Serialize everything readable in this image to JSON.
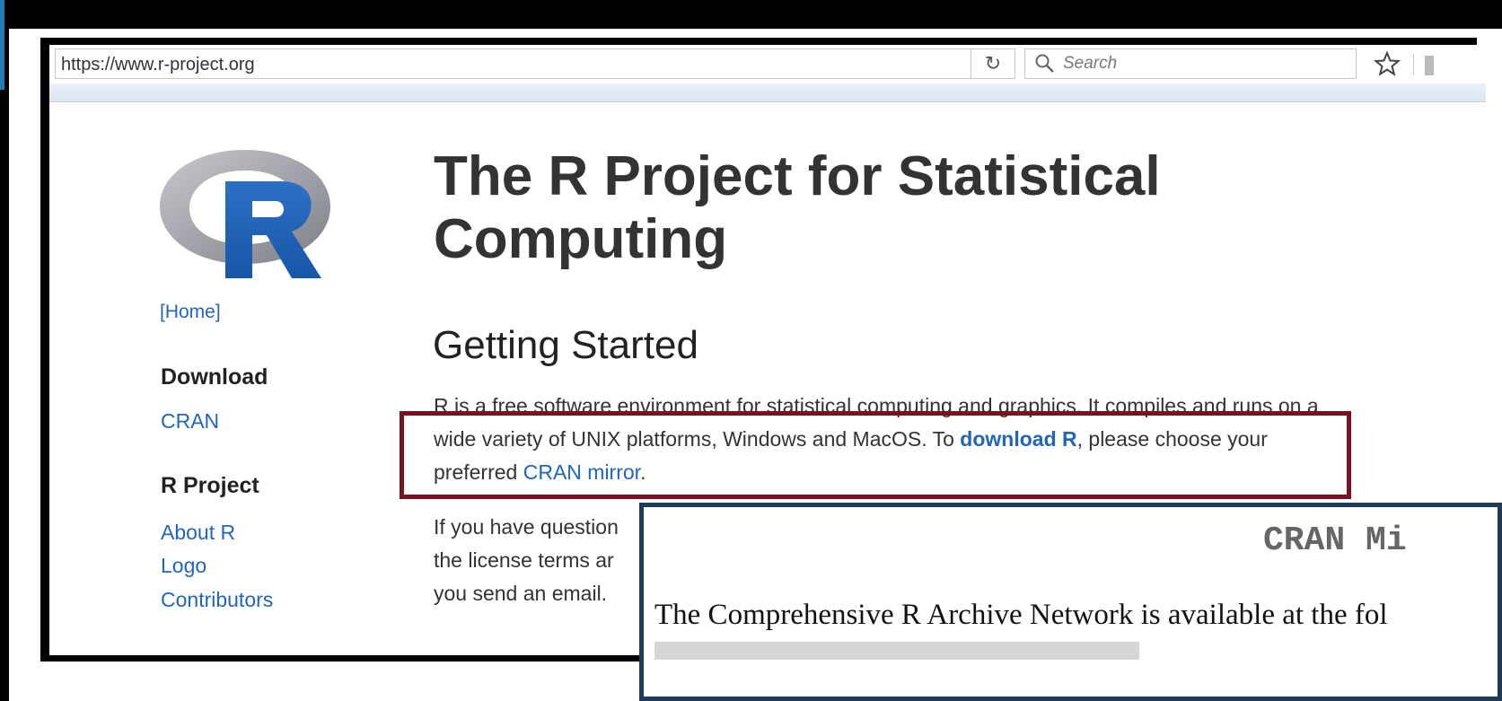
{
  "browser": {
    "url": "https://www.r-project.org",
    "search_placeholder": "Search"
  },
  "sidebar": {
    "home": "[Home]",
    "download_heading": "Download",
    "cran": "CRAN",
    "rproject_heading": "R Project",
    "links": [
      "About R",
      "Logo",
      "Contributors"
    ]
  },
  "main": {
    "title": "The R Project for Statistical Computing",
    "section": "Getting Started",
    "para_1": "R is a free software environment for statistical computing and graphics. It compiles and runs on a wide variety of UNIX platforms, Windows and MacOS. To ",
    "download_link": "download R",
    "para_2": ", please choose your preferred ",
    "cran_mirror_link": "CRAN mirror",
    "para_3": ".",
    "para2_line1": "If you have question",
    "para2_line2": "the license terms ar",
    "para2_line3": "you send an email."
  },
  "overlay": {
    "title": "CRAN Mi",
    "text": "The Comprehensive R Archive Network is available at the fol"
  },
  "colors": {
    "link": "#2266bb",
    "highlight_border": "#7a1020",
    "overlay_border": "#1d3b5a"
  }
}
